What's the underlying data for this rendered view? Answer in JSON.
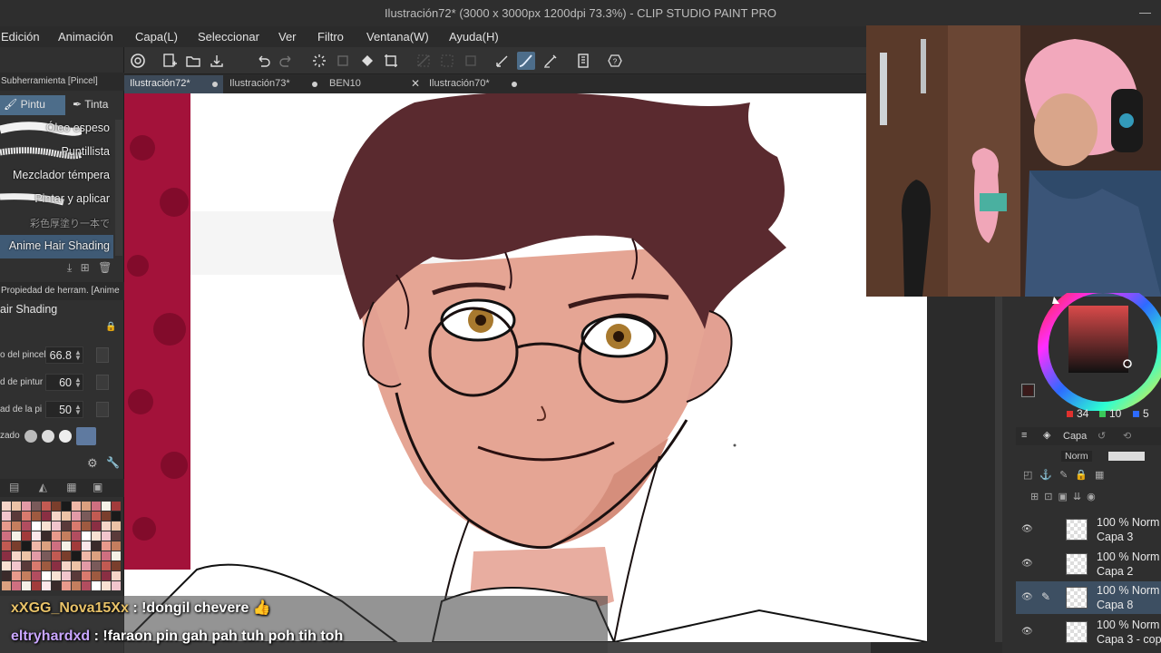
{
  "window": {
    "title": "Ilustración72* (3000 x 3000px 1200dpi 73.3%) - CLIP STUDIO PAINT PRO"
  },
  "menu": [
    "Edición",
    "Animación",
    "Capa(L)",
    "Seleccionar",
    "Ver",
    "Filtro",
    "Ventana(W)",
    "Ayuda(H)"
  ],
  "toolbar_icons": [
    "clip-studio-icon",
    "new-file-icon",
    "open-file-icon",
    "save-icon",
    "undo-icon",
    "redo-icon",
    "loading-icon",
    "transform-icon",
    "fill-icon",
    "crop-icon",
    "selection-icon",
    "lasso-icon",
    "deselect-icon",
    "pen-icon",
    "brush-icon",
    "pencil-icon",
    "ruler-icon",
    "help-icon"
  ],
  "doc_tabs": [
    {
      "label": "Ilustración72*",
      "active": true
    },
    {
      "label": "Ilustración73*",
      "active": false
    },
    {
      "label": "BEN10",
      "active": false
    },
    {
      "label": "Ilustración70*",
      "active": false
    }
  ],
  "left_panel": {
    "subtool_header": "Subherramienta [Pincel]",
    "subtabs": [
      "Pintu",
      "Tinta"
    ],
    "brushes": [
      "Óleo espeso",
      "Puntillista",
      "Mezclador témpera",
      "Pintar y aplicar",
      "彩色厚塗り一本で",
      "Anime Hair Shading"
    ],
    "property_header": "Propiedad de herram. [Anime",
    "property_brush": "air Shading",
    "properties": [
      {
        "name": "o del pincel",
        "value": "66.8"
      },
      {
        "name": "d de pintur",
        "value": "60"
      },
      {
        "name": "ad de la pi",
        "value": "50"
      }
    ],
    "shape_label": "zado"
  },
  "color": {
    "r": "34",
    "g": "10",
    "b": "5",
    "main_color": "#3a1a1a"
  },
  "layers": {
    "header": "Capa",
    "blend": "Norm",
    "items": [
      {
        "opacity": "100 % Norm",
        "name": "Capa 3",
        "selected": false
      },
      {
        "opacity": "100 % Norm",
        "name": "Capa 2",
        "selected": false
      },
      {
        "opacity": "100 % Norm",
        "name": "Capa 8",
        "selected": true
      },
      {
        "opacity": "100 % Norm",
        "name": "Capa 3 - cop",
        "selected": false
      }
    ]
  },
  "chat": [
    {
      "user": "xXGG_Nova15Xx",
      "message": ": !dongil chevere 👍"
    },
    {
      "user": "eltryhardxd",
      "message": ": !faraon pin gah pah tuh poh tih toh"
    }
  ],
  "status": {
    "zoom": "73.3"
  }
}
